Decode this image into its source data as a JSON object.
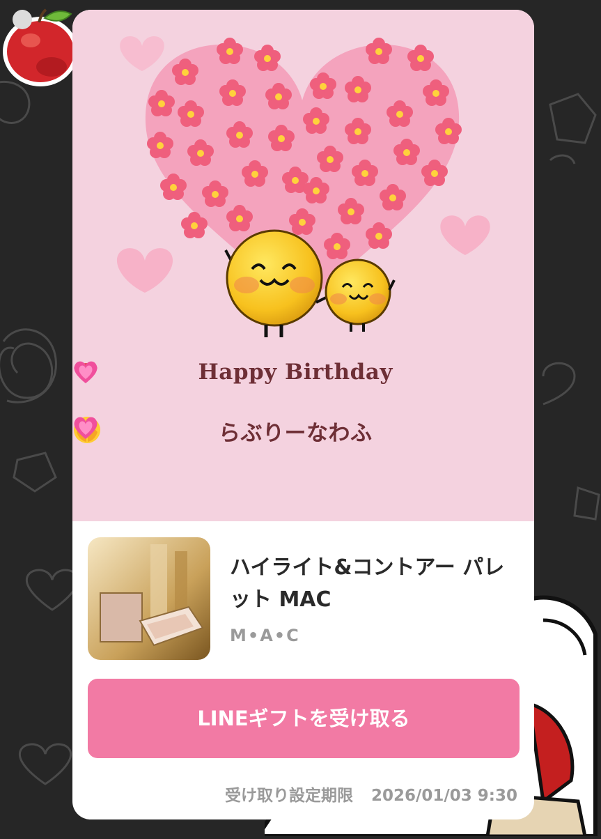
{
  "gift_card": {
    "message_line_1": "Happy Birthday",
    "message_line_2": "らぶりーなわふ",
    "product": {
      "name": "ハイライト&コントアー パレット MAC",
      "brand": "M•A•C"
    },
    "receive_button_label": "LINEギフトを受け取る",
    "deadline_label": "受け取り設定期限",
    "deadline_value": "2026/01/03 9:30"
  },
  "colors": {
    "background": "#262626",
    "card_hero": "#f4d2df",
    "button": "#f27aa4",
    "message_text": "#6e2f36"
  },
  "icons": [
    "apple-sticker-icon",
    "lips-emoji-icon",
    "heart-emoji-icon",
    "peeking-face-emoji-icon"
  ]
}
